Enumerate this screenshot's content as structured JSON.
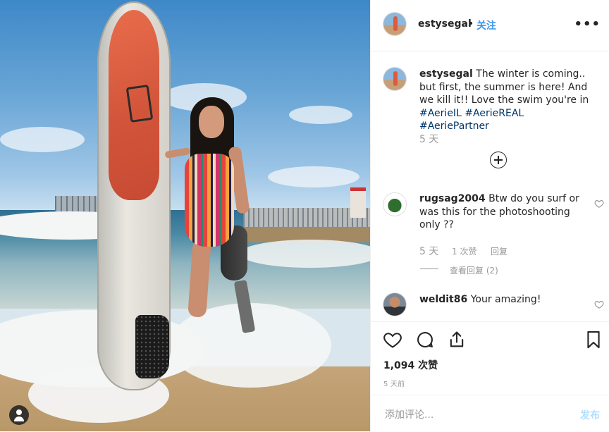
{
  "post": {
    "username": "estysegal",
    "follow_label": "关注",
    "separator": "•",
    "more_label": "•••"
  },
  "caption": {
    "username": "estysegal",
    "text": "The winter is coming.. but first, the summer is here! And we kill it!! Love the swim you're in",
    "hashtags": [
      "#AerieIL",
      "#AerieREAL",
      "#AeriePartner"
    ],
    "time": "5 天"
  },
  "comments": [
    {
      "username": "rugsag2004",
      "text": "Btw do you surf or was this for the photoshooting only ??",
      "time": "5 天",
      "likes": "1 次赞",
      "reply_label": "回复",
      "view_replies": "查看回复 (2)"
    },
    {
      "username": "weldit86",
      "text": "Your amazing!"
    }
  ],
  "actions": {
    "likes_count": "1,094 次赞",
    "posted_ago": "5 天前"
  },
  "add_comment": {
    "placeholder": "添加评论...",
    "post_label": "发布"
  },
  "colors": {
    "link_blue": "#3897f0",
    "hashtag": "#003569",
    "muted": "#999999",
    "post_disabled": "#b2dffc"
  }
}
